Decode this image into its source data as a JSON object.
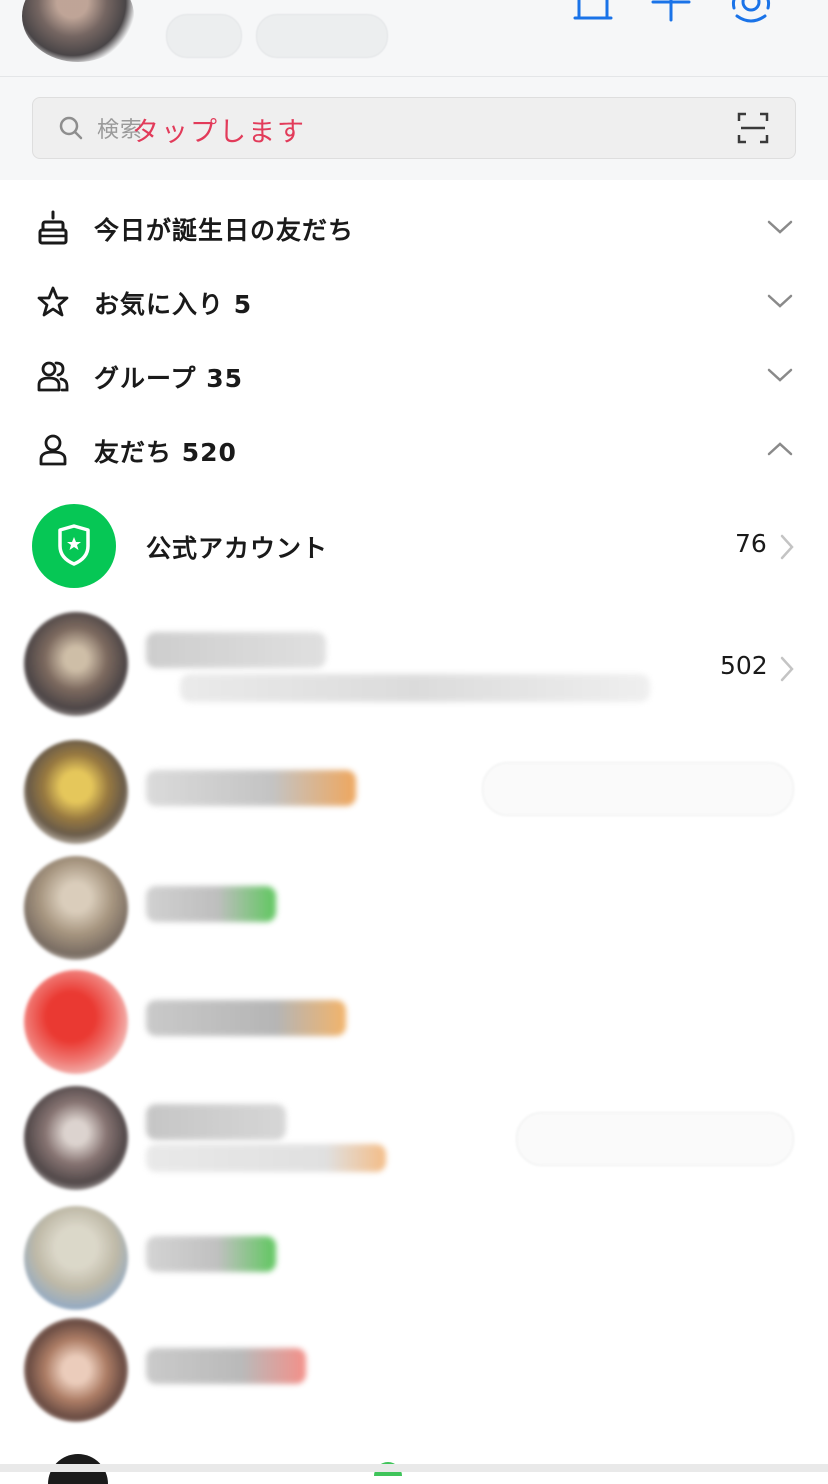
{
  "search": {
    "placeholder": "検索",
    "annotation": "タップします"
  },
  "header_icons": [
    "bell-icon",
    "add-friend-icon",
    "settings-gear-icon"
  ],
  "sections": [
    {
      "id": "birthdays",
      "label": "今日が誕生日の友だち",
      "icon": "cake-icon",
      "state": "collapsed"
    },
    {
      "id": "favorites",
      "label": "お気に入り 5",
      "icon": "star-icon",
      "state": "collapsed"
    },
    {
      "id": "groups",
      "label": "グループ 35",
      "icon": "group-icon",
      "state": "collapsed"
    },
    {
      "id": "friends",
      "label": "友だち 520",
      "icon": "person-icon",
      "state": "expanded"
    }
  ],
  "official_account": {
    "label": "公式アカウント",
    "count": "76"
  },
  "friends_list": {
    "first_row_count": "502"
  },
  "colors": {
    "line_green": "#06c755",
    "accent_blue": "#1a73e8",
    "annotation_red": "#e23b5a"
  }
}
